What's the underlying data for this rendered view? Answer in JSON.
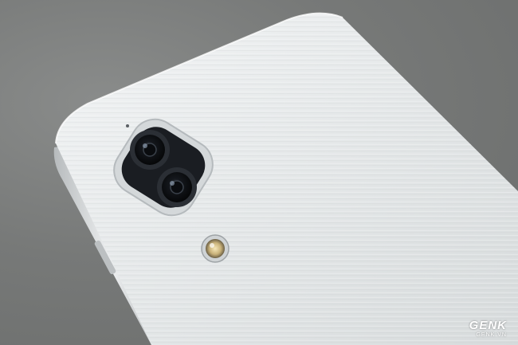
{
  "photo": {
    "subject": "phone-rear",
    "colors": {
      "background": "#757776",
      "phone_body": "#e9eced",
      "phone_frame": "#c9cdcf",
      "lens_ring": "#1a1d22",
      "skin": "#d9b4a0"
    }
  },
  "watermark": {
    "brand": "GENK",
    "domain": "GENK.VN"
  }
}
